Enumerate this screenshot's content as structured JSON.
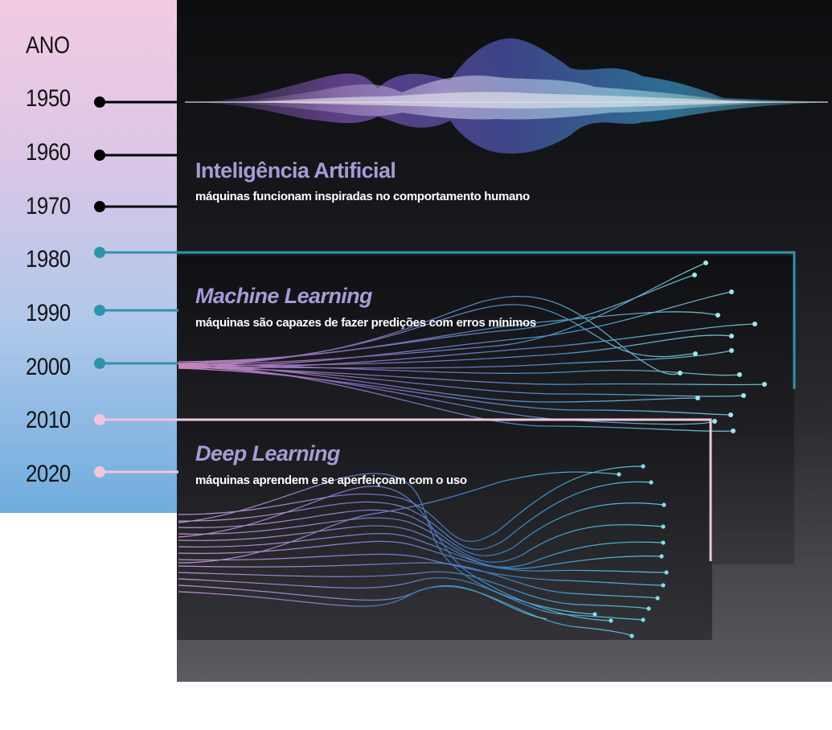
{
  "axis": {
    "header": "ANO",
    "years": [
      "1950",
      "1960",
      "1970",
      "1980",
      "1990",
      "2000",
      "2010",
      "2020"
    ]
  },
  "eras": [
    {
      "title": "Inteligência Artificial",
      "subtitle": "máquinas funcionam inspiradas no comportamento humano",
      "connector_years": [
        "1950",
        "1960",
        "1970"
      ],
      "color": "#000000"
    },
    {
      "title": "Machine Learning",
      "subtitle": "máquinas são capazes de fazer predições com erros mínimos",
      "connector_years": [
        "1980",
        "1990",
        "2000"
      ],
      "color": "#2f94aa"
    },
    {
      "title": "Deep Learning",
      "subtitle": "máquinas aprendem e se aperfeiçoam com o uso",
      "connector_years": [
        "2010",
        "2020"
      ],
      "color": "#f1c6dc"
    }
  ],
  "colors": {
    "sidebar_top": "#f3cbe2",
    "sidebar_bottom": "#6eaddd",
    "title": "#a99ad6",
    "wave_purple": "#7a52c8",
    "wave_blue": "#3fa6df",
    "wave_cyan": "#7be0f0"
  }
}
